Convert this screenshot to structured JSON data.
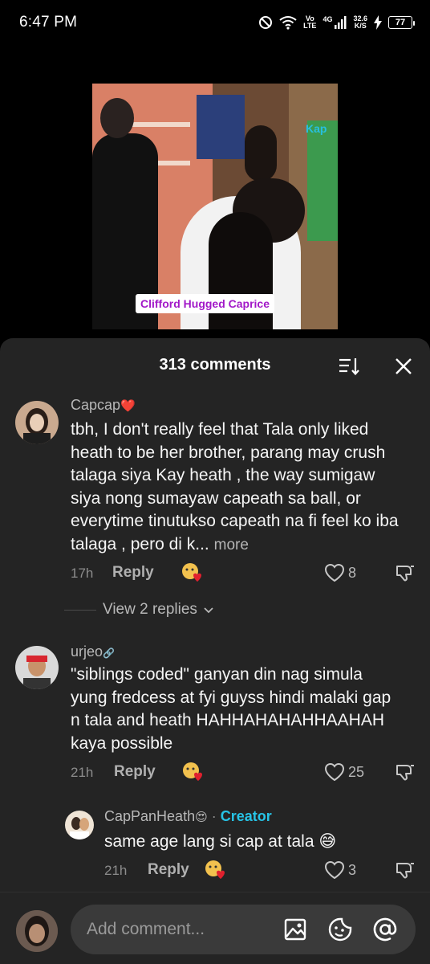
{
  "status": {
    "time": "6:47 PM",
    "volte_top": "Vo",
    "volte_bottom": "LTE",
    "network": "4G",
    "speed_value": "32.6",
    "speed_unit": "K/S",
    "battery": "77"
  },
  "video": {
    "caption": "Clifford Hugged Caprice",
    "logo_text": "Kap"
  },
  "comments_header": {
    "title": "313 comments",
    "sort_icon": "sort-icon",
    "close_icon": "close-icon"
  },
  "comments": [
    {
      "username": "Capcap",
      "username_suffix": "❤️",
      "text": "tbh, I don't really feel that Tala only liked heath to be her brother, parang may crush talaga siya Kay heath , the way sumigaw siya nong sumayaw capeath sa ball, or everytime tinutukso capeath na fi feel ko iba talaga , pero di k...",
      "more_label": "more",
      "time": "17h",
      "reply_label": "Reply",
      "likes": "8"
    },
    {
      "username": "urjeo",
      "username_suffix": "🔗",
      "text": "\"siblings coded\" ganyan din nag simula yung fredcess at fyi guyss hindi malaki gap n tala and heath HAHHAHAHAHHAAHAH kaya possible",
      "time": "21h",
      "reply_label": "Reply",
      "likes": "25"
    },
    {
      "username": "CapPanHeath",
      "username_suffix": "😍",
      "separator": "·",
      "creator_label": "Creator",
      "text": "same age lang si cap at tala 😅",
      "time": "21h",
      "reply_label": "Reply",
      "likes": "3"
    }
  ],
  "view_replies": "View 2 replies",
  "input": {
    "placeholder": "Add comment...",
    "icons": [
      "image-icon",
      "emoji-icon",
      "mention-icon"
    ]
  },
  "colors": {
    "sheet_bg": "#242424",
    "creator": "#27c3e6",
    "caption": "#a218c8",
    "heart_red": "#e0202e"
  }
}
